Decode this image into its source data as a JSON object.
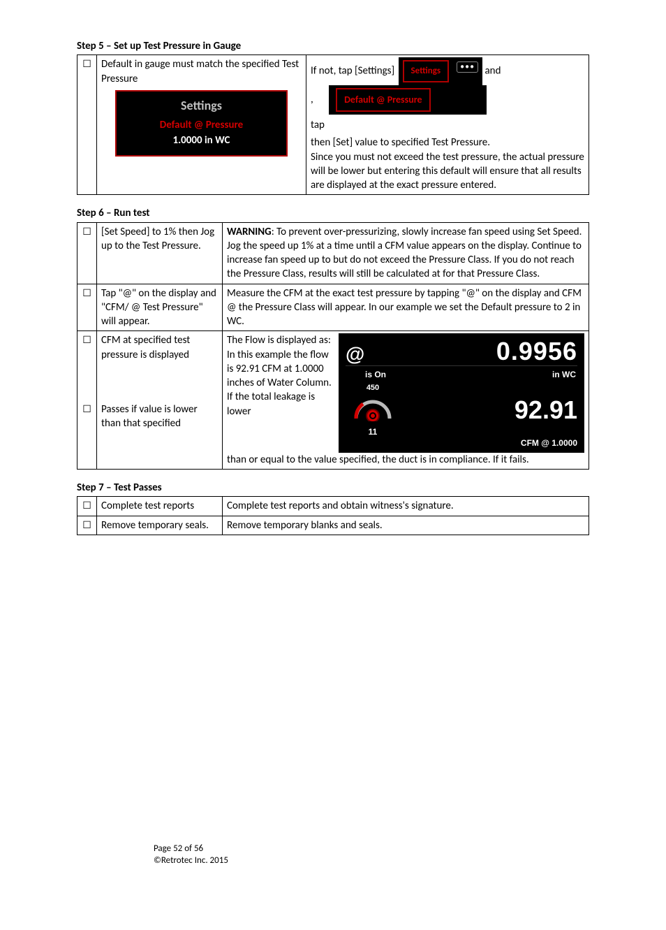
{
  "step5": {
    "heading": "Step 5 – Set up Test Pressure in Gauge",
    "checkbox": "☐",
    "left_text": "Default in gauge must match the specified Test Pressure",
    "panel": {
      "title": "Settings",
      "red": "Default @ Pressure",
      "white": "1.0000 in WC"
    },
    "right": {
      "l1a": "If not, tap [Settings]",
      "settings_btn": "Settings",
      "l1b": "and",
      "comma": ",",
      "default_btn": "Default @ Pressure",
      "tap": "tap",
      "l3": " then [Set] value to specified Test Pressure.",
      "l4": "Since you must not exceed the test pressure, the actual pressure will be lower but entering this default will ensure that all results are displayed at the exact pressure entered."
    }
  },
  "step6": {
    "heading": "Step 6 – Run test",
    "rows": [
      {
        "checkbox": "☐",
        "left": "[Set Speed] to 1% then Jog up to the Test Pressure.",
        "right_bold": "WARNING",
        "right_rest": ": To prevent over-pressurizing, slowly increase fan speed using Set Speed.  Jog the speed up 1% at a time until a CFM value appears on the display. Continue to increase fan speed up to but do not exceed the Pressure Class. If you do not reach the Pressure Class, results will still be calculated at for that Pressure Class."
      },
      {
        "checkbox": "☐",
        "left": "Tap \"@\" on the display and \"CFM/ @ Test Pressure\" will appear.",
        "right": "Measure the CFM at the exact test pressure by tapping \"@\" on the display and CFM @ the Pressure Class will appear. In our example we set the Default pressure to 2 in WC."
      }
    ],
    "row3": {
      "cb1": "☐",
      "left1": "CFM at specified test pressure is displayed",
      "cb2": "☐",
      "left2": "Passes if value is lower than that specified",
      "textcol": "The Flow is displayed as:\nIn this example the flow is 92.91 CFM at 1.0000 inches of Water Column.\nIf the total leakage is lower",
      "after": "than or equal to the value specified, the duct is in compliance. If it fails."
    },
    "gauge": {
      "at": "@",
      "v1": "0.9956",
      "ison": "is On",
      "inwc": "in WC",
      "dial_top": "450",
      "dial_bottom": "11",
      "v2": "92.91",
      "cfm": "CFM @ 1.0000"
    }
  },
  "step7": {
    "heading": "Step 7 – Test Passes",
    "rows": [
      {
        "checkbox": "☐",
        "left": "Complete test reports",
        "right": "Complete test reports and obtain witness's signature."
      },
      {
        "checkbox": "☐",
        "left": "Remove temporary seals.",
        "right": "Remove temporary blanks and seals."
      }
    ]
  },
  "footer": {
    "page": "Page 52 of 56",
    "copyright": "©Retrotec Inc. 2015"
  }
}
